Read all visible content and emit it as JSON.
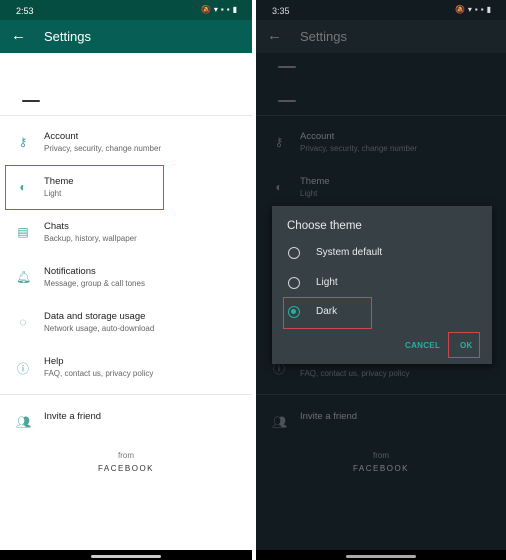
{
  "left": {
    "time": "2:53",
    "title": "Settings",
    "items": [
      {
        "title": "Account",
        "subtitle": "Privacy, security, change number",
        "icon": "key-icon"
      },
      {
        "title": "Theme",
        "subtitle": "Light",
        "icon": "theme-icon"
      },
      {
        "title": "Chats",
        "subtitle": "Backup, history, wallpaper",
        "icon": "chat-icon"
      },
      {
        "title": "Notifications",
        "subtitle": "Message, group & call tones",
        "icon": "bell-icon"
      },
      {
        "title": "Data and storage usage",
        "subtitle": "Network usage, auto-download",
        "icon": "data-usage-icon"
      },
      {
        "title": "Help",
        "subtitle": "FAQ, contact us, privacy policy",
        "icon": "help-icon"
      }
    ],
    "invite": "Invite a friend",
    "from": "from",
    "brand": "FACEBOOK"
  },
  "right": {
    "time": "3:35",
    "title": "Settings",
    "items": [
      {
        "title": "Account",
        "subtitle": "Privacy, security, change number"
      },
      {
        "title": "Theme",
        "subtitle": "Light"
      },
      {
        "title": "",
        "subtitle": ""
      },
      {
        "title": "",
        "subtitle": ""
      },
      {
        "title": "",
        "subtitle": ""
      },
      {
        "title": "",
        "subtitle": "FAQ, contact us, privacy policy"
      }
    ],
    "invite": "Invite a friend",
    "from": "from",
    "brand": "FACEBOOK",
    "dialog": {
      "title": "Choose theme",
      "options": [
        "System default",
        "Light",
        "Dark"
      ],
      "selected": "Dark",
      "cancel": "CANCEL",
      "ok": "OK"
    }
  },
  "colors": {
    "accent": "#22b3a0",
    "header": "#075e54",
    "highlight": "#d0464e"
  }
}
